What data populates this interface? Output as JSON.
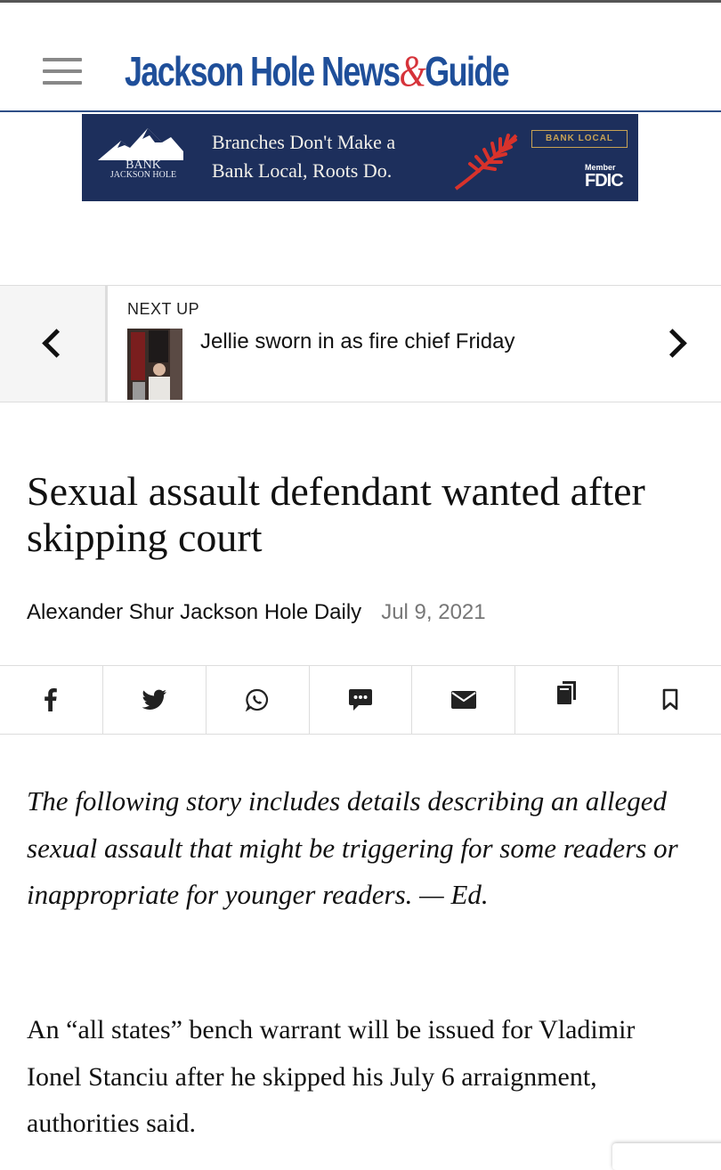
{
  "header": {
    "logo_text_1": "Jackson Hole News",
    "logo_amp": "&",
    "logo_text_2": "Guide"
  },
  "ad": {
    "bank_name_line1": "BANK",
    "bank_name_line2": "JACKSON HOLE",
    "headline_line1": "Branches Don't Make a",
    "headline_line2": "Bank Local, Roots Do.",
    "tag": "BANK LOCAL",
    "member": "Member",
    "fdic": "FDIC"
  },
  "next_up": {
    "label": "NEXT UP",
    "title": "Jellie sworn in as fire chief Friday"
  },
  "article": {
    "headline": "Sexual assault defendant wanted after skipping court",
    "byline": "Alexander Shur Jackson Hole Daily",
    "date": "Jul 9, 2021",
    "intro": "The following story includes details describing an alleged sexual assault that might be triggering for some readers or inappropriate for younger readers. — Ed.",
    "body_paragraph": "An “all states” bench warrant will be issued for Vladimir Ionel Stanciu after he skipped his July 6 arraignment, authorities said."
  },
  "share_bar": {
    "icons": [
      "facebook-icon",
      "twitter-icon",
      "whatsapp-icon",
      "sms-icon",
      "email-icon",
      "copy-icon",
      "bookmark-icon"
    ]
  },
  "colors": {
    "brand_blue": "#1f4f9a",
    "brand_red": "#d6333a",
    "ad_background": "#1d2f5c",
    "ad_gold": "#c8a354"
  }
}
